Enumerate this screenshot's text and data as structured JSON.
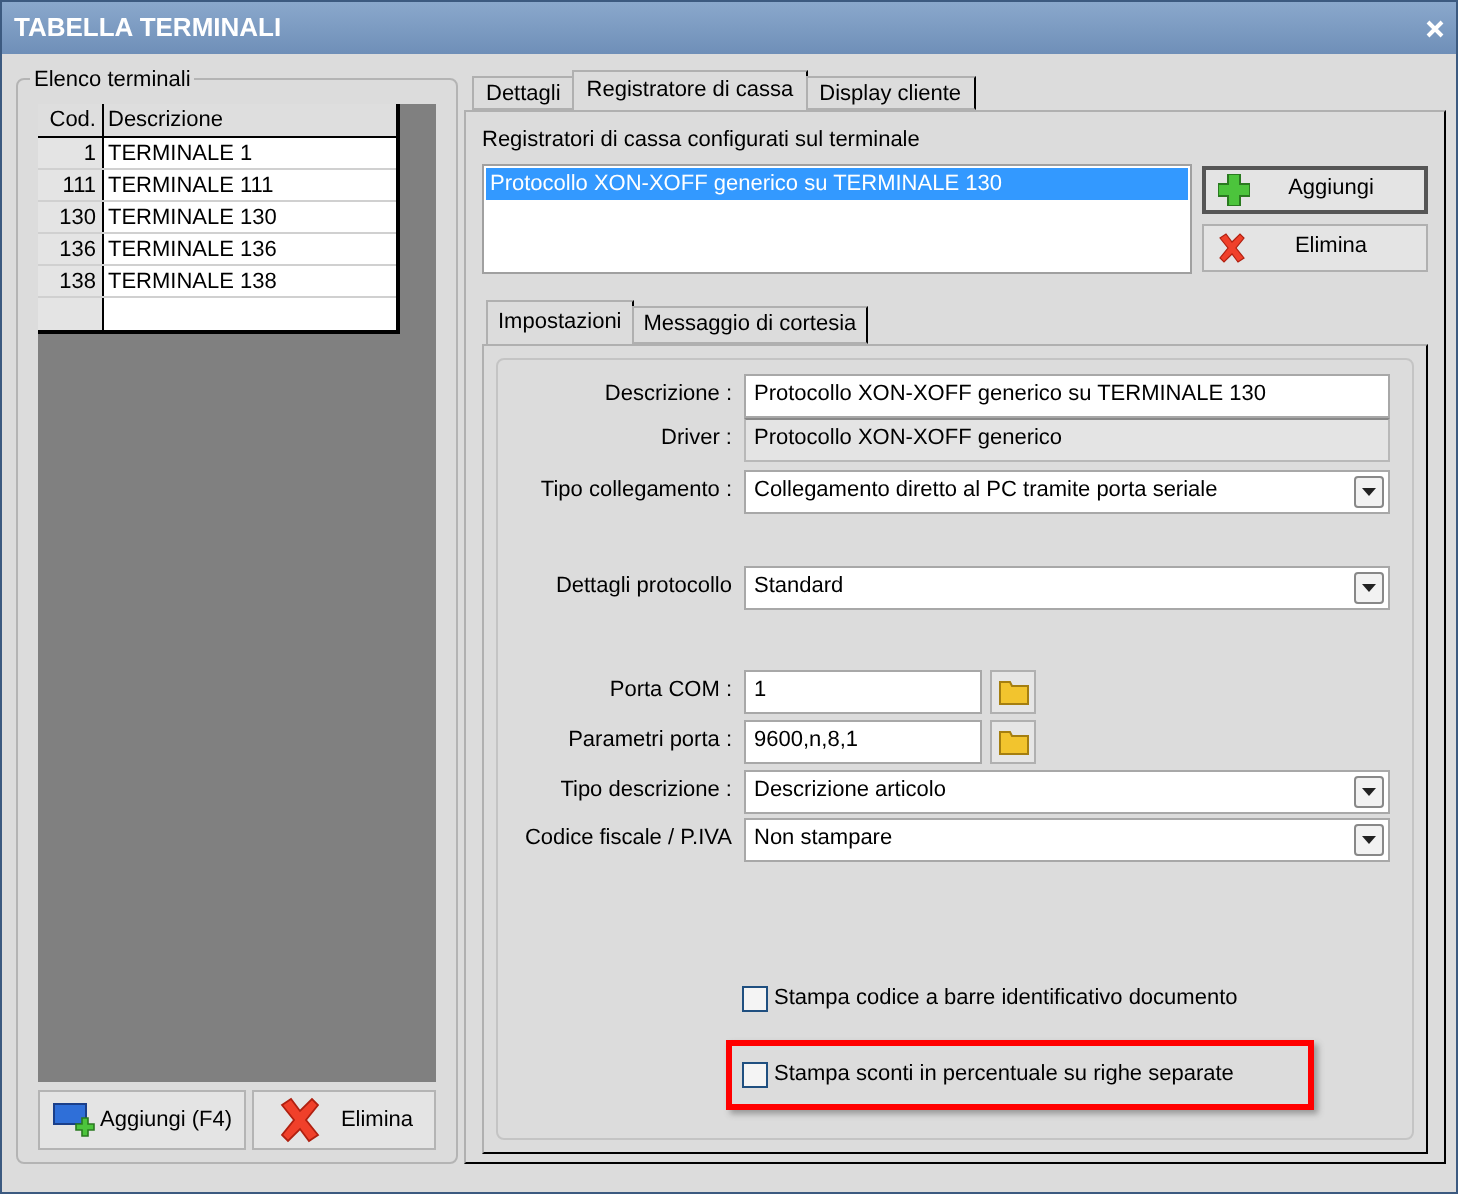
{
  "window": {
    "title": "TABELLA TERMINALI"
  },
  "terminals": {
    "title": "Elenco terminali",
    "columns": [
      "Cod.",
      "Descrizione"
    ],
    "rows": [
      {
        "code": "1",
        "description": "TERMINALE 1"
      },
      {
        "code": "111",
        "description": "TERMINALE 111"
      },
      {
        "code": "130",
        "description": "TERMINALE 130"
      },
      {
        "code": "136",
        "description": "TERMINALE 136"
      },
      {
        "code": "138",
        "description": "TERMINALE 138"
      }
    ],
    "buttons": [
      {
        "label": "Aggiungi (F4)",
        "kind": "add"
      },
      {
        "label": "Elimina",
        "kind": "delete"
      }
    ]
  },
  "tabs": [
    {
      "label": "Dettagli",
      "selected": false
    },
    {
      "label": "Registratore di cassa",
      "selected": true
    },
    {
      "label": "Display cliente",
      "selected": false
    }
  ],
  "registers": {
    "label": "Registratori di cassa configurati sul terminale",
    "items": [
      {
        "text": "Protocollo XON-XOFF generico su TERMINALE 130",
        "selected": true
      }
    ],
    "buttons": [
      {
        "label": "Aggiungi",
        "kind": "add"
      },
      {
        "label": "Elimina",
        "kind": "delete"
      }
    ]
  },
  "inner_tabs": [
    {
      "label": "Impostazioni",
      "selected": true
    },
    {
      "label": "Messaggio di cortesia",
      "selected": false
    }
  ],
  "fields": [
    {
      "label": "Descrizione :",
      "value": "Protocollo XON-XOFF generico su TERMINALE 130",
      "kind": "text"
    },
    {
      "label": "Driver :",
      "value": "Protocollo XON-XOFF generico",
      "kind": "readonly"
    },
    {
      "label": "Tipo collegamento :",
      "value": "Collegamento diretto al PC tramite porta seriale",
      "kind": "select"
    },
    {
      "label": "Dettagli protocollo",
      "value": "Standard",
      "kind": "select"
    },
    {
      "label": "Porta COM :",
      "value": "1",
      "kind": "browse"
    },
    {
      "label": "Parametri porta :",
      "value": "9600,n,8,1",
      "kind": "browse"
    },
    {
      "label": "Tipo descrizione :",
      "value": "Descrizione articolo",
      "kind": "select"
    },
    {
      "label": "Codice fiscale / P.IVA",
      "value": "Non stampare",
      "kind": "select"
    }
  ],
  "checkboxes": [
    {
      "label": "Stampa codice a barre identificativo documento",
      "checked": false,
      "highlighted": false
    },
    {
      "label": "Stampa sconti in percentuale su righe separate",
      "checked": false,
      "highlighted": true
    }
  ]
}
